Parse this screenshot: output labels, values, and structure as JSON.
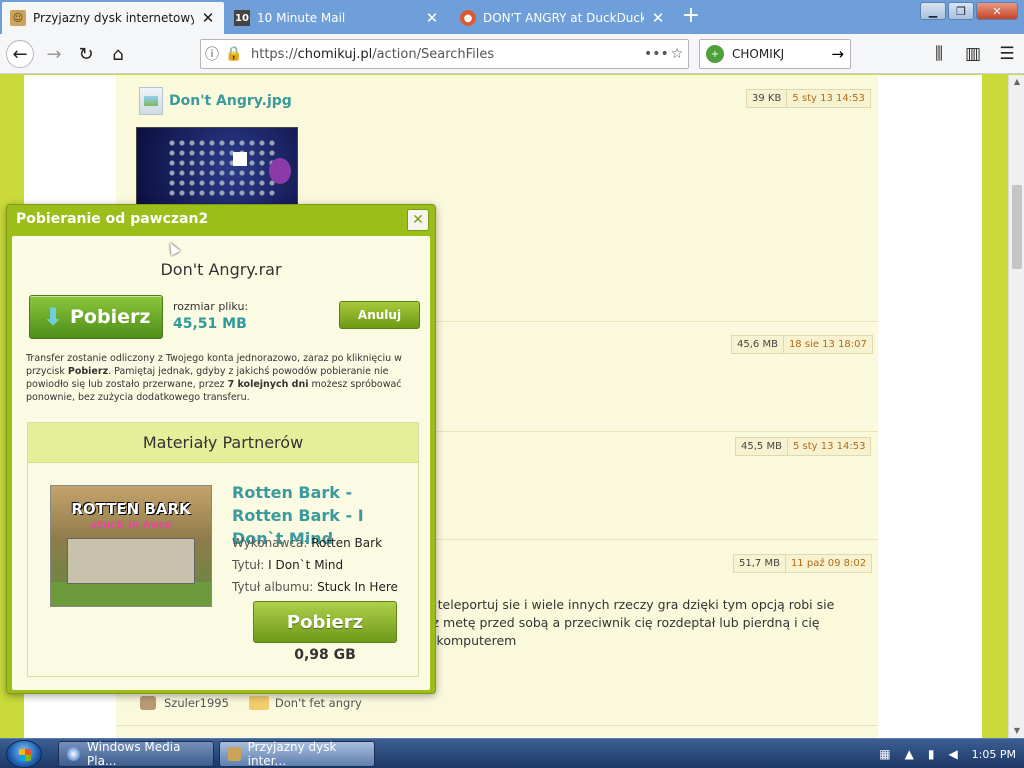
{
  "browser": {
    "tabs": [
      {
        "title": "Przyjazny dysk internetowy - Ch",
        "favicon": "chomikuj-favicon",
        "active": true
      },
      {
        "title": "10 Minute Mail",
        "favicon": "10minutemail-favicon",
        "favicon_text": "10",
        "active": false
      },
      {
        "title": "DON'T ANGRY at DuckDuckGo",
        "favicon": "duckduckgo-favicon",
        "active": false
      }
    ],
    "url_prefix": "https://",
    "url_domain": "chomikuj.pl",
    "url_path": "/action/SearchFiles",
    "search_text": "CHOMIKJ"
  },
  "page": {
    "first_file": {
      "name": "Don't Angry.jpg",
      "size": "39 KB",
      "date": "5 sty 13 14:53"
    },
    "rows": [
      {
        "size": "45,6 MB",
        "date": "18 sie 13 18:07"
      },
      {
        "size": "45,5 MB",
        "date": "5 sty 13 14:53"
      },
      {
        "size": "51,7 MB",
        "date": "11 paź 09 8:02"
      }
    ],
    "description": "a teleportuj sie i wiele innych rzeczy gra dzięki tym opcją robi sie\nsz metę przed sobą a przeciwnik cię rozdeptał lub pierdną i cię\nz komputerem",
    "user": "Szuler1995",
    "folder": "Don't fet angry"
  },
  "modal": {
    "title": "Pobieranie od pawczan2",
    "close": "✕",
    "file_name": "Don't Angry.rar",
    "download_label": "Pobierz",
    "size_label": "rozmiar pliku:",
    "size_value": "45,51 MB",
    "cancel_label": "Anuluj",
    "info_1": "Transfer zostanie odliczony z Twojego konta jednorazowo, zaraz po kliknięciu w przycisk ",
    "info_bold_1": "Pobierz",
    "info_2": ". Pamiętaj jednak, gdyby z jakichś powodów pobieranie nie powiodło się lub zostało przerwane, przez ",
    "info_bold_2": "7 kolejnych dni",
    "info_3": " możesz spróbować ponownie, bez zużycia dodatkowego transferu.",
    "partners": {
      "heading": "Materiały Partnerów",
      "album_title": "Rotten Bark - Rotten Bark - I Don`t Mind",
      "cover_title": "ROTTEN BARK",
      "cover_subtitle": "stuck in here",
      "artist_label": "Wykonawca: ",
      "artist": "Rotten Bark",
      "title_label": "Tytuł: ",
      "title": "I Don`t Mind",
      "album_label": "Tytuł albumu: ",
      "album": "Stuck In Here",
      "download_label": "Pobierz",
      "size": "0,98 GB"
    }
  },
  "taskbar": {
    "tasks": [
      {
        "label": "Windows Media Pla..."
      },
      {
        "label": "Przyjazny dysk inter..."
      }
    ],
    "time": "1:05 PM"
  },
  "colors": {
    "page_green": "#c9da3a",
    "modal_green": "#9cbe1a",
    "teal_link": "#3b9a9b",
    "date_orange": "#b46a14"
  }
}
